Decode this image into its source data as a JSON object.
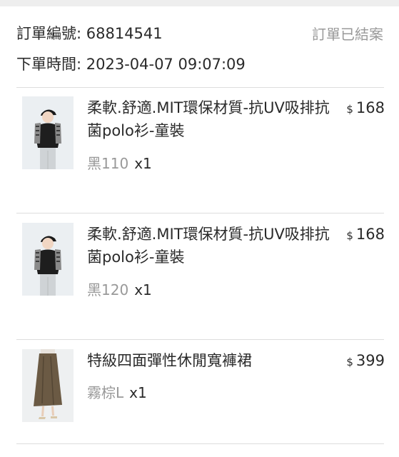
{
  "order": {
    "number_label": "訂單編號: 68814541",
    "status": "訂單已結案",
    "time_label": "下單時間: 2023-04-07 09:07:09"
  },
  "items": [
    {
      "name": "柔軟.舒適.MIT環保材質-抗UV吸排抗菌polo衫-童裝",
      "currency": "$",
      "price": "168",
      "variant": "黑110",
      "quantity": "x1",
      "image": "child-polo-photo"
    },
    {
      "name": "柔軟.舒適.MIT環保材質-抗UV吸排抗菌polo衫-童裝",
      "currency": "$",
      "price": "168",
      "variant": "黑120",
      "quantity": "x1",
      "image": "child-polo-photo"
    },
    {
      "name": "特級四面彈性休閒寬褲裙",
      "currency": "$",
      "price": "399",
      "variant": "霧棕L",
      "quantity": "x1",
      "image": "culottes-photo"
    }
  ]
}
